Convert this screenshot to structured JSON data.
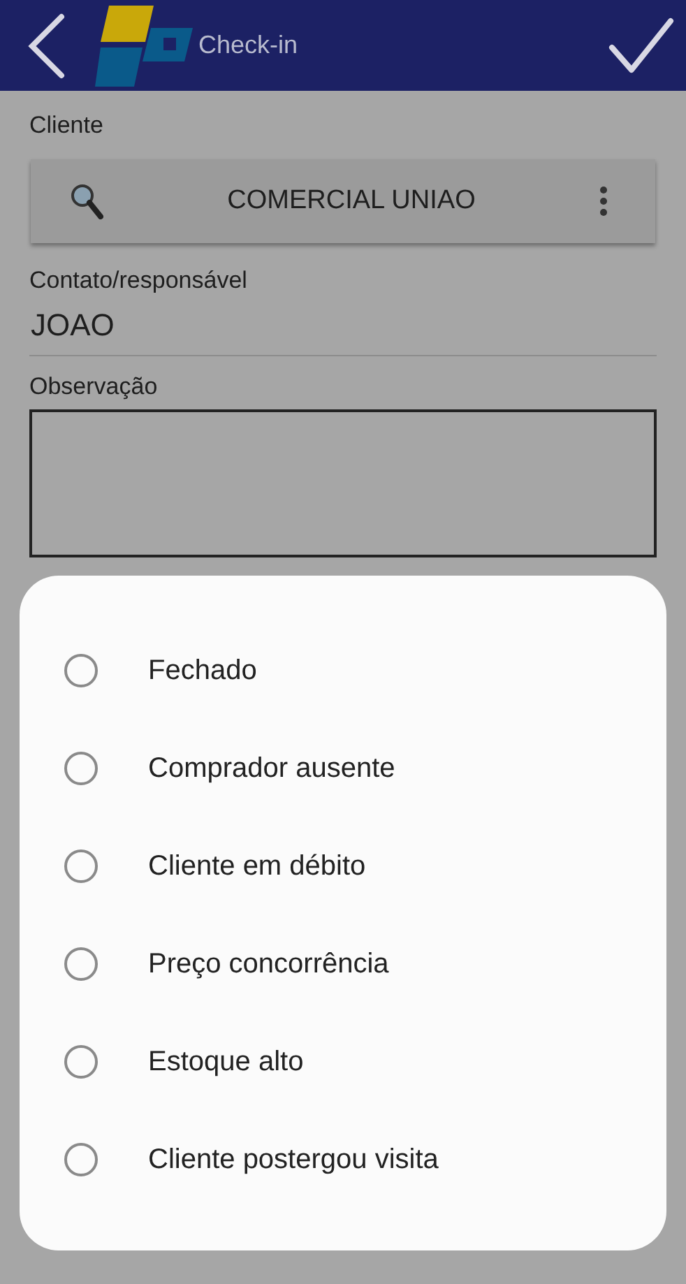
{
  "header": {
    "title": "Check-in"
  },
  "form": {
    "client_label": "Cliente",
    "client_value": "COMERCIAL UNIAO",
    "contact_label": "Contato/responsável",
    "contact_value": "JOAO",
    "notes_label": "Observação"
  },
  "dialog": {
    "options": [
      {
        "label": "Fechado",
        "selected": false
      },
      {
        "label": "Comprador ausente",
        "selected": false
      },
      {
        "label": "Cliente em débito",
        "selected": false
      },
      {
        "label": "Preço concorrência",
        "selected": false
      },
      {
        "label": "Estoque alto",
        "selected": false
      },
      {
        "label": "Cliente postergou visita",
        "selected": false
      }
    ]
  }
}
